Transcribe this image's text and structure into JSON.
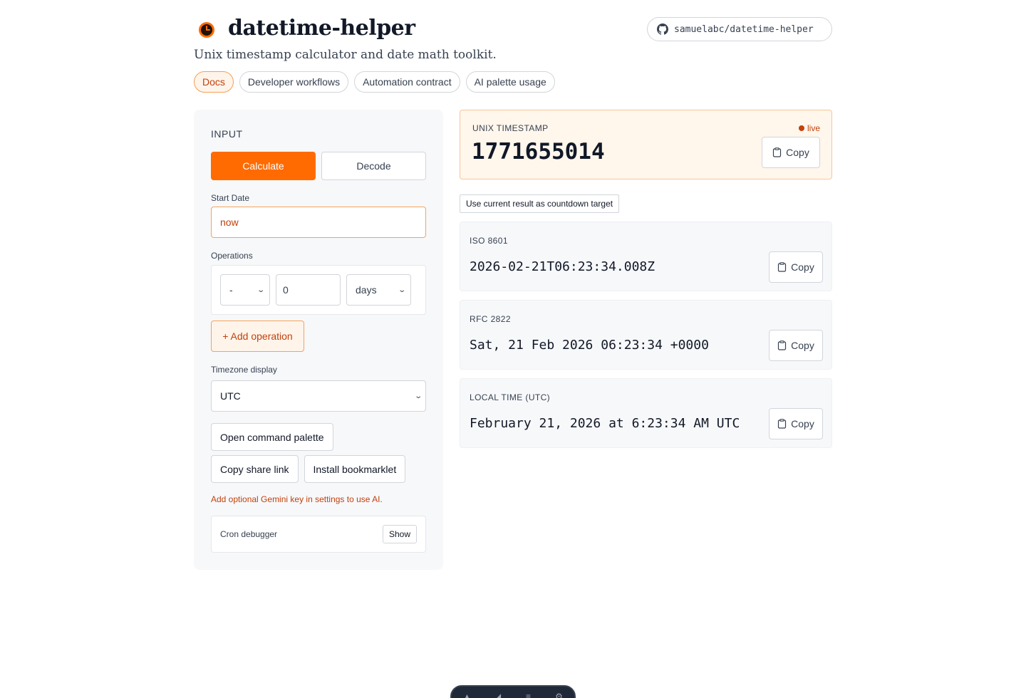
{
  "header": {
    "title": "datetime-helper",
    "subtitle": "Unix timestamp calculator and date math toolkit.",
    "repo_link": "samuelabc/datetime-helper",
    "brand_color": "#ff6b00"
  },
  "tabs": [
    {
      "label": "Docs",
      "active": true
    },
    {
      "label": "Developer workflows",
      "active": false
    },
    {
      "label": "Automation contract",
      "active": false
    },
    {
      "label": "AI palette usage",
      "active": false
    }
  ],
  "input_panel": {
    "title": "INPUT",
    "mode_buttons": {
      "calculate": "Calculate",
      "decode": "Decode",
      "active": "Calculate"
    },
    "start_date": {
      "label": "Start Date",
      "value": "now"
    },
    "operations": {
      "label": "Operations",
      "rows": [
        {
          "sign": "-",
          "amount": "0",
          "unit": "days"
        }
      ],
      "add_label": "+ Add operation"
    },
    "timezone": {
      "label": "Timezone display",
      "value": "UTC"
    },
    "actions": {
      "command_palette": "Open command palette",
      "share_link": "Copy share link",
      "bookmarklet": "Install bookmarklet"
    },
    "ai_hint": "Add optional Gemini key in settings to use AI.",
    "cron": {
      "label": "Cron debugger",
      "toggle_label": "Show"
    }
  },
  "result": {
    "timestamp": {
      "label": "UNIX TIMESTAMP",
      "value": "1771655014",
      "status": "live",
      "copy_label": "Copy"
    },
    "countdown_button": "Use current result as countdown target",
    "formats": [
      {
        "label": "ISO 8601",
        "value": "2026-02-21T06:23:34.008Z",
        "copy_label": "Copy"
      },
      {
        "label": "RFC 2822",
        "value": "Sat, 21 Feb 2026 06:23:34 +0000",
        "copy_label": "Copy"
      },
      {
        "label": "LOCAL TIME (UTC)",
        "value": "February 21, 2026 at 6:23:34 AM UTC",
        "copy_label": "Copy"
      }
    ]
  },
  "icons": [
    "clock-logo-icon",
    "github-icon",
    "chevron-down-icon",
    "clipboard-icon"
  ]
}
